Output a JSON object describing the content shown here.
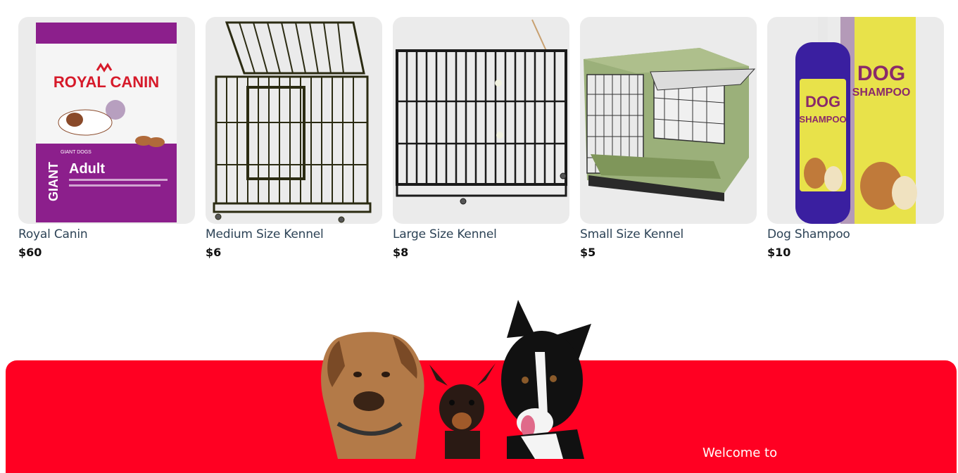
{
  "products": [
    {
      "name": "Royal Canin",
      "price": "$60",
      "image_label": "royal-canin-bag",
      "package_text": {
        "brand": "ROYAL CANIN",
        "line": "GIANT",
        "stage": "Adult",
        "sub": "GIANT DOGS"
      }
    },
    {
      "name": "Medium Size Kennel",
      "price": "$6",
      "image_label": "kennel-medium"
    },
    {
      "name": "Large Size Kennel",
      "price": "$8",
      "image_label": "kennel-large"
    },
    {
      "name": "Small Size Kennel",
      "price": "$5",
      "image_label": "kennel-small"
    },
    {
      "name": "Dog Shampoo",
      "price": "$10",
      "image_label": "dog-shampoo",
      "package_text": {
        "line1": "DOG",
        "line2": "SHAMPOO"
      }
    }
  ],
  "hero": {
    "welcome": "Welcome to",
    "background_color": "#ff0022"
  },
  "colors": {
    "card_bg": "#ebebeb",
    "name_text": "#2d4356",
    "price_text": "#111111",
    "kennel_green": "#9bb07a",
    "royal_purple": "#8c1f8c",
    "shampoo_yellow": "#e8e24a",
    "shampoo_bottle": "#3a1fa0"
  }
}
